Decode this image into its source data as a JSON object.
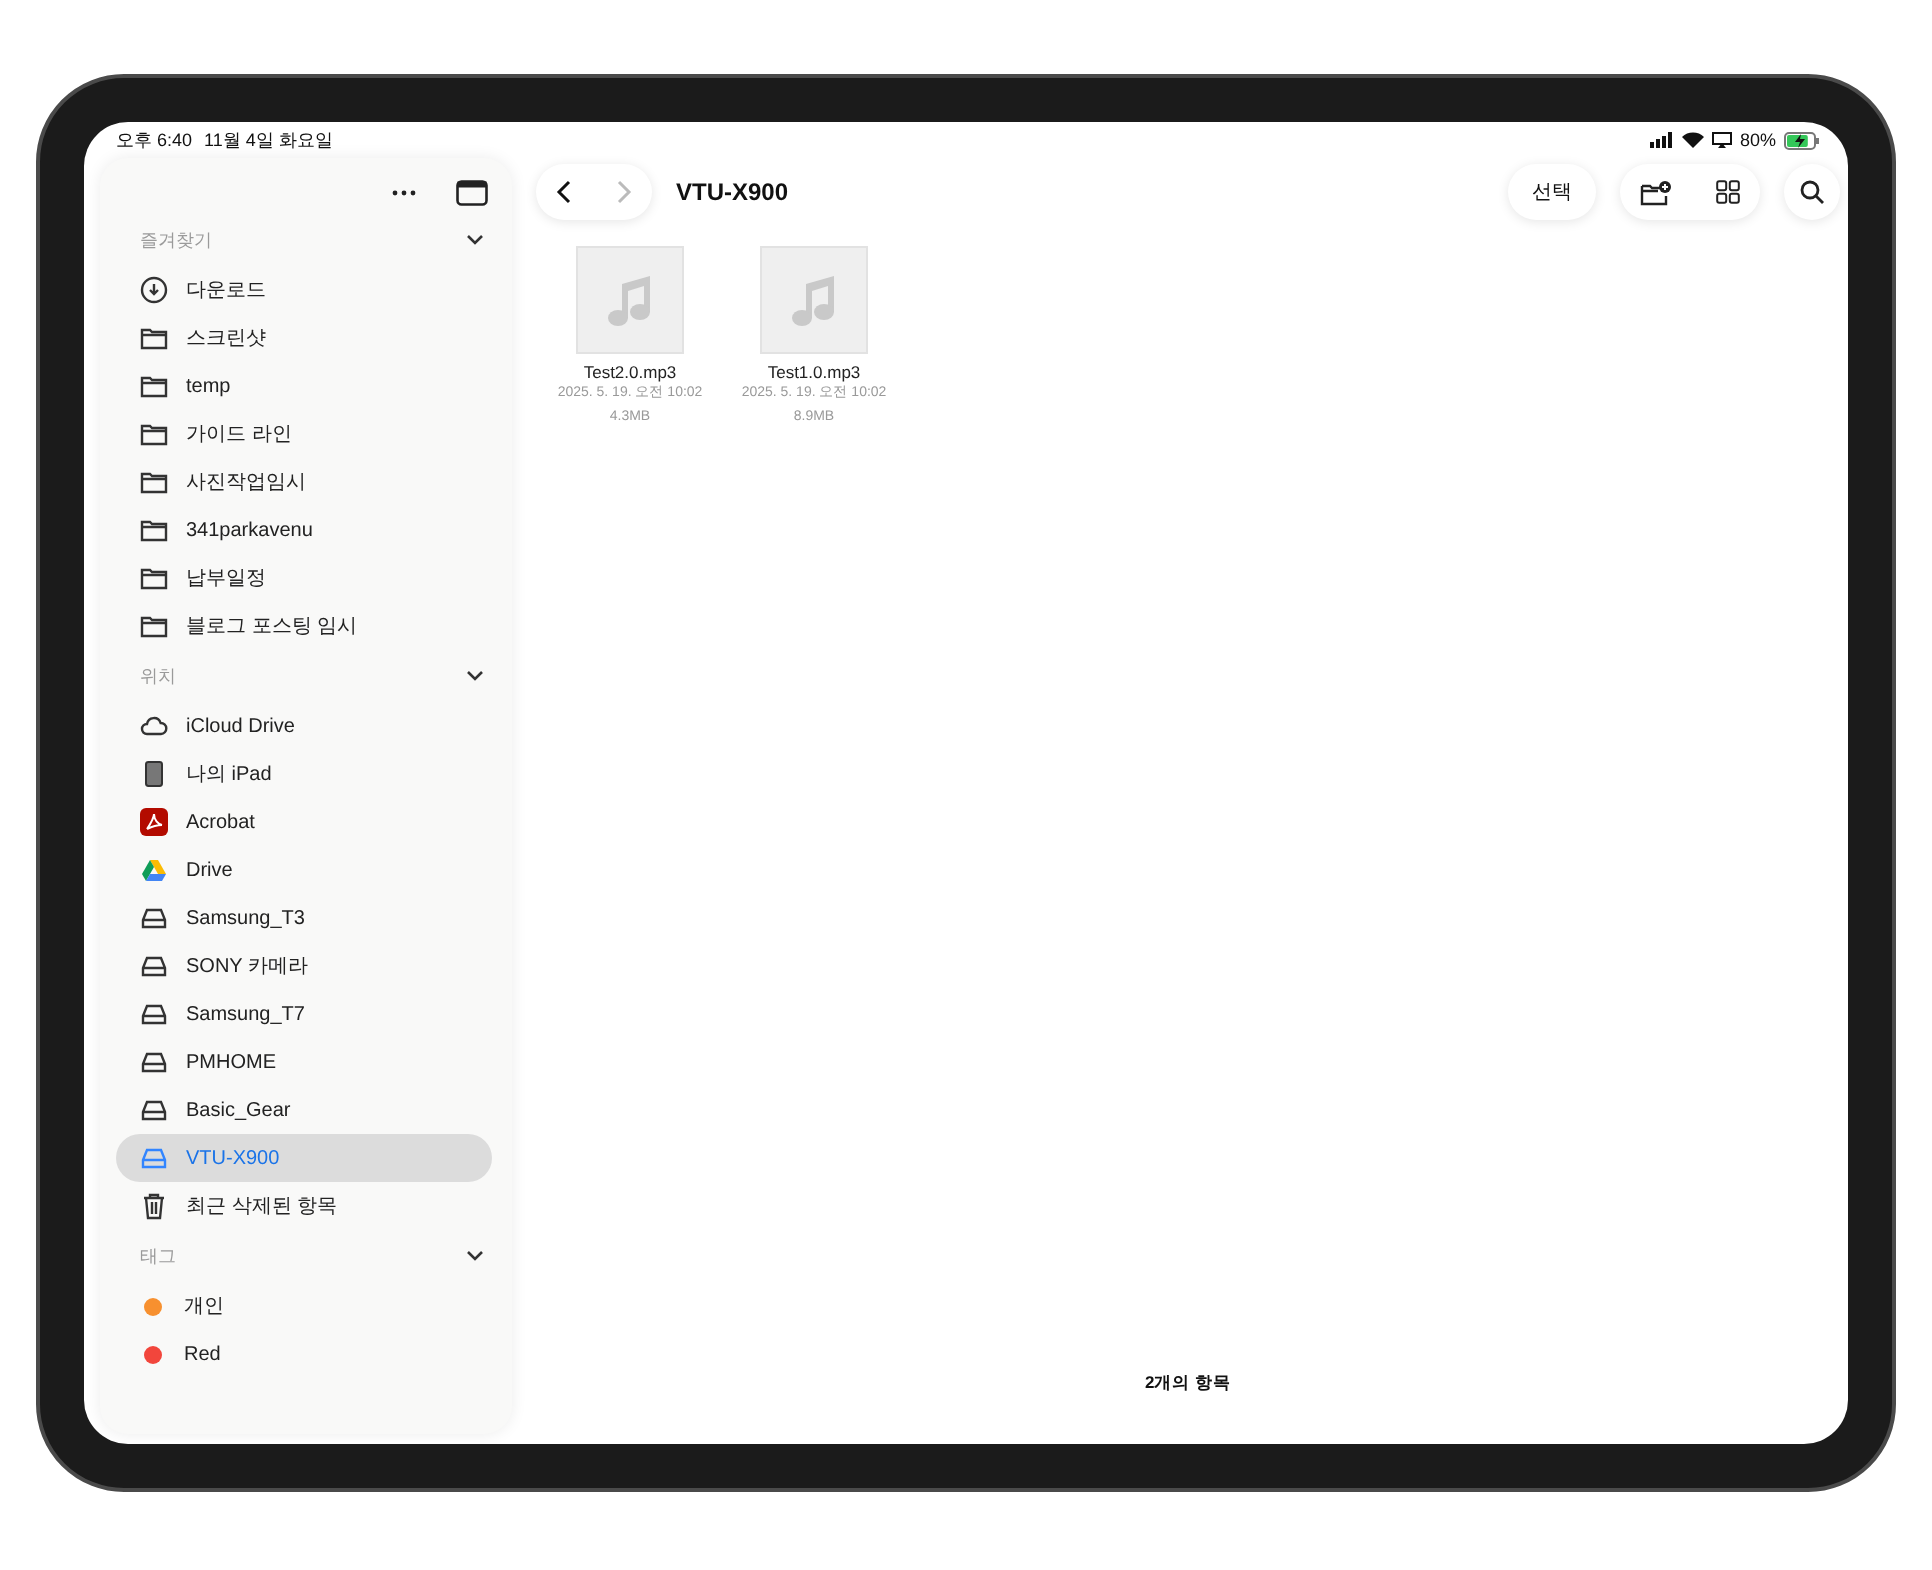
{
  "status_bar": {
    "time": "오후 6:40",
    "date": "11월 4일 화요일",
    "battery": "80%"
  },
  "sidebar": {
    "sections": [
      {
        "title": "즐겨찾기",
        "expanded": true,
        "items": [
          {
            "label": "다운로드",
            "kind": "download",
            "selected": false
          },
          {
            "label": "스크린샷",
            "kind": "folder",
            "selected": false
          },
          {
            "label": "temp",
            "kind": "folder",
            "selected": false
          },
          {
            "label": "가이드 라인",
            "kind": "folder",
            "selected": false
          },
          {
            "label": "사진작업임시",
            "kind": "folder",
            "selected": false
          },
          {
            "label": "341parkavenu",
            "kind": "folder",
            "selected": false
          },
          {
            "label": "납부일정",
            "kind": "folder",
            "selected": false
          },
          {
            "label": "블로그 포스팅 임시",
            "kind": "folder",
            "selected": false
          }
        ]
      },
      {
        "title": "위치",
        "expanded": true,
        "items": [
          {
            "label": "iCloud Drive",
            "kind": "cloud",
            "selected": false
          },
          {
            "label": "나의 iPad",
            "kind": "ipad",
            "selected": false
          },
          {
            "label": "Acrobat",
            "kind": "acrobat",
            "selected": false
          },
          {
            "label": "Drive",
            "kind": "gdrive",
            "selected": false
          },
          {
            "label": "Samsung_T3",
            "kind": "disk",
            "selected": false
          },
          {
            "label": "SONY 카메라",
            "kind": "disk",
            "selected": false
          },
          {
            "label": "Samsung_T7",
            "kind": "disk",
            "selected": false
          },
          {
            "label": "PMHOME",
            "kind": "disk",
            "selected": false
          },
          {
            "label": "Basic_Gear",
            "kind": "disk",
            "selected": false
          },
          {
            "label": "VTU-X900",
            "kind": "disk",
            "selected": true
          },
          {
            "label": "최근 삭제된 항목",
            "kind": "trash",
            "selected": false
          }
        ]
      },
      {
        "title": "태그",
        "expanded": true,
        "items": [
          {
            "label": "개인",
            "kind": "tag",
            "color": "#f7902f",
            "selected": false
          },
          {
            "label": "Red",
            "kind": "tag",
            "color": "#f2463c",
            "selected": false
          }
        ]
      }
    ]
  },
  "toolbar": {
    "title": "VTU-X900",
    "select_button": "선택",
    "back_enabled": true,
    "forward_enabled": false
  },
  "files": [
    {
      "name": "Test2.0.mp3",
      "date": "2025. 5. 19. 오전 10:02",
      "size": "4.3MB"
    },
    {
      "name": "Test1.0.mp3",
      "date": "2025. 5. 19. 오전 10:02",
      "size": "8.9MB"
    }
  ],
  "footer": "2개의 항목"
}
